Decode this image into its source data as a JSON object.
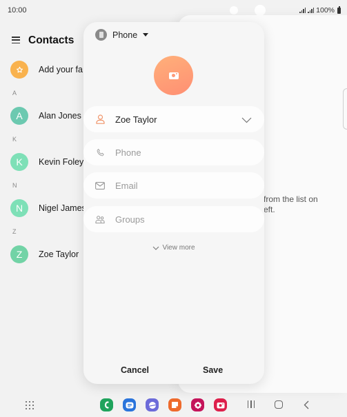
{
  "status_bar": {
    "time": "10:00",
    "battery": "100%"
  },
  "contacts": {
    "title": "Contacts",
    "favorites_prompt": "Add your fa",
    "sections": [
      {
        "letter": "A",
        "contacts": [
          {
            "initial": "A",
            "name": "Alan Jones"
          }
        ]
      },
      {
        "letter": "K",
        "contacts": [
          {
            "initial": "K",
            "name": "Kevin Foley"
          }
        ]
      },
      {
        "letter": "N",
        "contacts": [
          {
            "initial": "N",
            "name": "Nigel James"
          }
        ]
      },
      {
        "letter": "Z",
        "contacts": [
          {
            "initial": "Z",
            "name": "Zoe Taylor"
          }
        ]
      }
    ],
    "colors": {
      "favorites": "#f9b24e",
      "avatar_a": "#6cc9b0",
      "avatar_k": "#7ee0b7",
      "avatar_n": "#7ee0b7",
      "avatar_z": "#72d3a6"
    }
  },
  "detail": {
    "hint_line1": "from the list on",
    "hint_line2": "eft."
  },
  "edit_sheet": {
    "storage_label": "Phone",
    "fields": {
      "name": {
        "value": "Zoe Taylor"
      },
      "phone": {
        "placeholder": "Phone"
      },
      "email": {
        "placeholder": "Email"
      },
      "groups": {
        "placeholder": "Groups"
      }
    },
    "view_more": "View more",
    "cancel": "Cancel",
    "save": "Save",
    "accent_color": "#ff9a78"
  },
  "nav_bar": {
    "dock_apps": [
      {
        "name": "phone",
        "color": "#1fa35c"
      },
      {
        "name": "messages",
        "color": "#2a74db"
      },
      {
        "name": "internet",
        "color": "#6c6bd9"
      },
      {
        "name": "notes",
        "color": "#ee6a2c"
      },
      {
        "name": "gallery",
        "color": "#c4145a"
      },
      {
        "name": "camera",
        "color": "#dd1f4b"
      }
    ]
  }
}
